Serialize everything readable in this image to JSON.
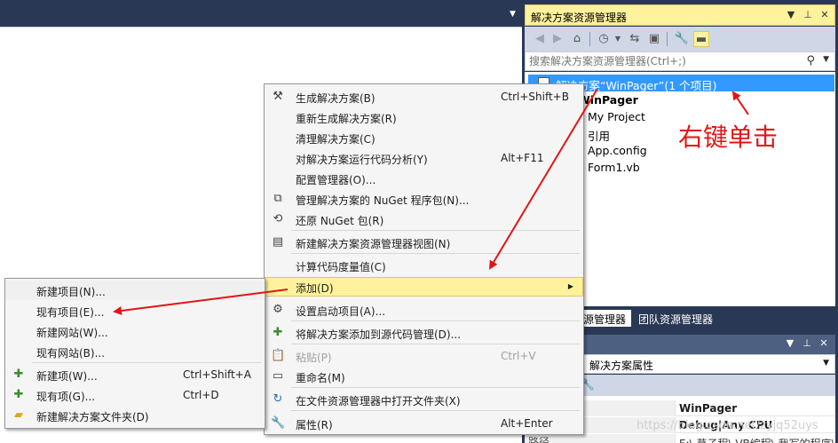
{
  "solution_explorer": {
    "title": "解决方案资源管理器",
    "search_placeholder": "搜索解决方案资源管理器(Ctrl+;)",
    "tree": [
      {
        "label": "解决方案“WinPager”(1 个项目)"
      },
      {
        "label": "WinPager"
      },
      {
        "label": "My Project"
      },
      {
        "label": "引用"
      },
      {
        "label": "App.config"
      },
      {
        "label": "Form1.vb"
      }
    ],
    "tabs": [
      "解决方案资源管理器",
      "团队资源管理器"
    ]
  },
  "properties": {
    "selector": "解决方案属性",
    "rows": [
      {
        "key": "",
        "value": "WinPager"
      },
      {
        "key": "",
        "value": "Debug|Any CPU"
      },
      {
        "key": "路径",
        "value": "E:\\ 草子程\\ VB编程\\ 我写的程序\\"
      }
    ]
  },
  "main_menu": {
    "items": [
      {
        "icon": "build-icon",
        "label": "生成解决方案(B)",
        "shortcut": "Ctrl+Shift+B"
      },
      {
        "icon": "",
        "label": "重新生成解决方案(R)",
        "shortcut": ""
      },
      {
        "icon": "",
        "label": "清理解决方案(C)",
        "shortcut": ""
      },
      {
        "icon": "",
        "label": "对解决方案运行代码分析(Y)",
        "shortcut": "Alt+F11"
      },
      {
        "icon": "",
        "label": "配置管理器(O)...",
        "shortcut": ""
      },
      {
        "icon": "nuget-icon",
        "label": "管理解决方案的 NuGet 程序包(N)...",
        "shortcut": ""
      },
      {
        "icon": "restore-icon",
        "label": "还原 NuGet 包(R)",
        "shortcut": ""
      },
      {
        "icon": "new-view-icon",
        "label": "新建解决方案资源管理器视图(N)",
        "shortcut": ""
      },
      {
        "icon": "",
        "label": "计算代码度量值(C)",
        "shortcut": ""
      },
      {
        "icon": "",
        "label": "添加(D)",
        "shortcut": ""
      },
      {
        "icon": "gear-icon",
        "label": "设置启动项目(A)...",
        "shortcut": ""
      },
      {
        "icon": "source-control-icon",
        "label": "将解决方案添加到源代码管理(D)...",
        "shortcut": ""
      },
      {
        "icon": "paste-icon",
        "label": "粘贴(P)",
        "shortcut": "Ctrl+V"
      },
      {
        "icon": "rename-icon",
        "label": "重命名(M)",
        "shortcut": ""
      },
      {
        "icon": "refresh-icon",
        "label": "在文件资源管理器中打开文件夹(X)",
        "shortcut": ""
      },
      {
        "icon": "wrench-icon",
        "label": "属性(R)",
        "shortcut": "Alt+Enter"
      }
    ]
  },
  "add_submenu": {
    "items": [
      {
        "icon": "",
        "label": "新建项目(N)...",
        "shortcut": ""
      },
      {
        "icon": "",
        "label": "现有项目(E)...",
        "shortcut": ""
      },
      {
        "icon": "",
        "label": "新建网站(W)...",
        "shortcut": ""
      },
      {
        "icon": "",
        "label": "现有网站(B)...",
        "shortcut": ""
      },
      {
        "icon": "new-item-icon",
        "label": "新建项(W)...",
        "shortcut": "Ctrl+Shift+A"
      },
      {
        "icon": "existing-item-icon",
        "label": "现有项(G)...",
        "shortcut": "Ctrl+D"
      },
      {
        "icon": "new-folder-icon",
        "label": "新建解决方案文件夹(D)",
        "shortcut": ""
      }
    ]
  },
  "annotation": "右键单击",
  "watermark": "https://blog.csdn.net/zyjq52uys",
  "colors": {
    "annotation": "#e21515",
    "highlight": "#fff29d",
    "selection": "#3399ff",
    "chrome": "#293955"
  }
}
